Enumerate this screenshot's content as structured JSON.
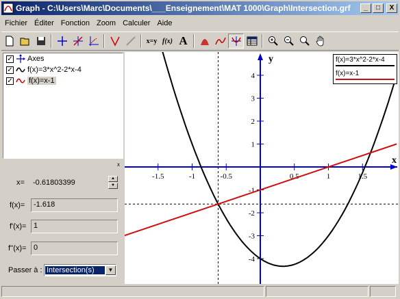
{
  "window": {
    "title": "Graph - C:\\Users\\Marc\\Documents\\___Enseignement\\MAT 1000\\Graph\\Intersection.grf"
  },
  "title_buttons": {
    "minimize": "_",
    "maximize": "□",
    "close": "X"
  },
  "menu": [
    "Fichier",
    "Éditer",
    "Fonction",
    "Zoom",
    "Calculer",
    "Aide"
  ],
  "toolbar": {
    "xy_label": "x=y",
    "fx_label": "f(x)",
    "text_label": "A"
  },
  "tree": {
    "items": [
      {
        "label": "Axes",
        "checked": "✓",
        "icon": "axes-icon"
      },
      {
        "label": "f(x)=3*x^2-2*x-4",
        "checked": "✓",
        "icon": "black-curve-icon"
      },
      {
        "label": "f(x)=x-1",
        "checked": "✓",
        "icon": "red-curve-icon"
      }
    ]
  },
  "calc_panel": {
    "close": "x",
    "x_label": "x=",
    "x_value": "-0.61803399",
    "fx_label": "f(x)=",
    "fx_value": "-1.618",
    "fpx_label": "f'(x)=",
    "fpx_value": "1",
    "fppx_label": "f''(x)=",
    "fppx_value": "0",
    "goto_label": "Passer à :",
    "goto_value": "Intersection(s)"
  },
  "legend": [
    {
      "label": "f(x)=3*x^2-2*x-4",
      "color": "#000000"
    },
    {
      "label": "f(x)=x-1",
      "color": "#cc1111"
    }
  ],
  "graph": {
    "axis_color": "#0000cc",
    "x_axis_label": "x",
    "y_axis_label": "y",
    "x_ticks": [
      "-1.5",
      "-1",
      "-0.5",
      "0.5",
      "1",
      "1.5"
    ],
    "y_ticks": [
      "4",
      "3",
      "2",
      "1",
      "-1",
      "-2",
      "-3",
      "-4"
    ],
    "intersection": {
      "x": -0.618,
      "y": -1.618
    },
    "curve_color": "#000000",
    "line_color": "#cc1111"
  }
}
